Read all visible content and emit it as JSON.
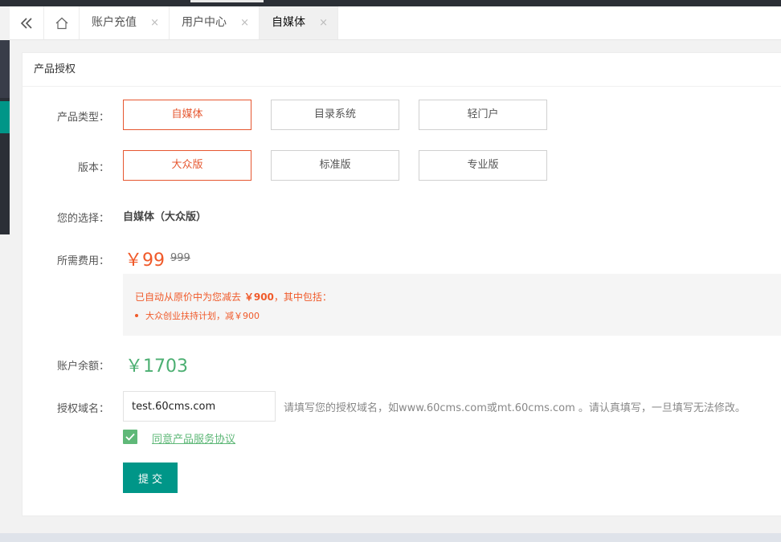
{
  "tabs": {
    "items": [
      {
        "label": "账户充值"
      },
      {
        "label": "用户中心"
      },
      {
        "label": "自媒体"
      }
    ],
    "close_glyph": "×"
  },
  "card": {
    "title": "产品授权"
  },
  "form": {
    "product_type": {
      "label": "产品类型：",
      "options": [
        "自媒体",
        "目录系统",
        "轻门户"
      ],
      "selected": "自媒体"
    },
    "version": {
      "label": "版本：",
      "options": [
        "大众版",
        "标准版",
        "专业版"
      ],
      "selected": "大众版"
    },
    "choice": {
      "label": "您的选择：",
      "value": "自媒体（大众版）"
    },
    "fee": {
      "label": "所需费用：",
      "price": "￥99",
      "original": "999",
      "discount_line_prefix": "已自动从原价中为您减去",
      "discount_amount": "￥900",
      "discount_line_suffix": "，其中包括：",
      "discount_item": "大众创业扶持计划，减￥900"
    },
    "balance": {
      "label": "账户余额：",
      "value": "￥1703"
    },
    "domain": {
      "label": "授权域名：",
      "value": "test.60cms.com",
      "hint": "请填写您的授权域名，如www.60cms.com或mt.60cms.com 。请认真填写，一旦填写无法修改。"
    },
    "agreement": {
      "checked": true,
      "label": "同意产品服务协议"
    },
    "submit_label": "提交"
  },
  "colors": {
    "accent_selected": "#e65730",
    "price": "#f05a2a",
    "balance": "#4caf72",
    "primary": "#009688",
    "checkbox": "#5fb878"
  }
}
